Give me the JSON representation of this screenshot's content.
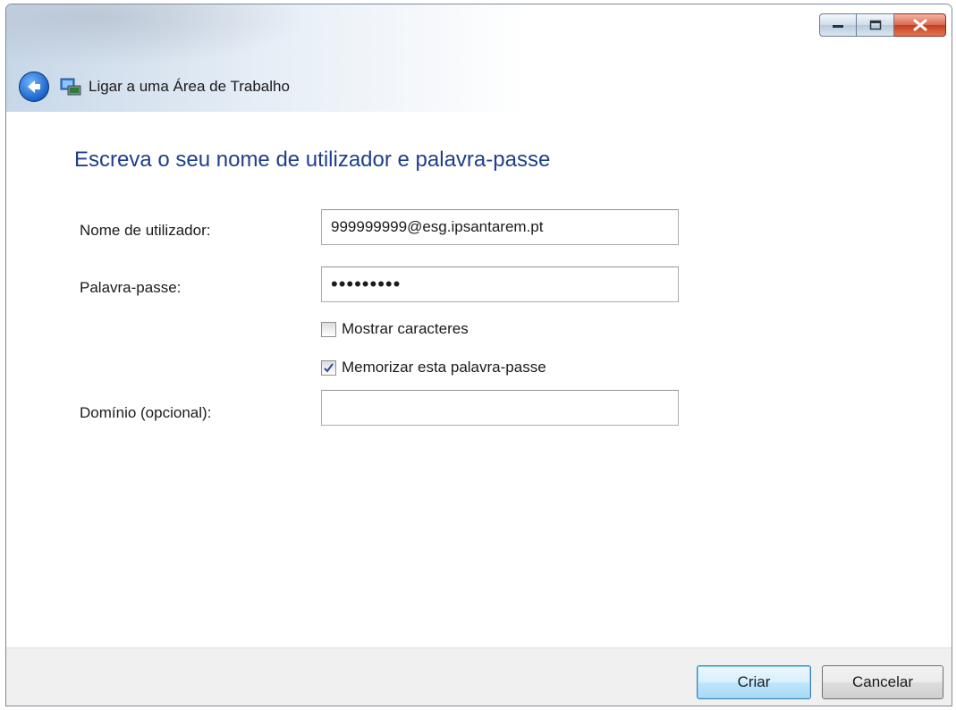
{
  "window": {
    "title": "Ligar a uma Área de Trabalho",
    "controls": {
      "minimize_icon": "minimize-icon",
      "maximize_icon": "maximize-icon",
      "close_icon": "close-icon"
    }
  },
  "main": {
    "heading": "Escreva o seu nome de utilizador e palavra-passe",
    "username": {
      "label": "Nome de utilizador:",
      "value": "999999999@esg.ipsantarem.pt"
    },
    "password": {
      "label": "Palavra-passe:",
      "value": "•••••••••"
    },
    "show_chars": {
      "label": "Mostrar caracteres",
      "checked": false
    },
    "remember": {
      "label": "Memorizar esta palavra-passe",
      "checked": true
    },
    "domain": {
      "label": "Domínio (opcional):",
      "value": ""
    }
  },
  "footer": {
    "create_label": "Criar",
    "cancel_label": "Cancelar"
  },
  "colors": {
    "heading": "#1e3f8c",
    "back_button": "#1a64c8",
    "footer_bg": "#f0f0f0"
  }
}
